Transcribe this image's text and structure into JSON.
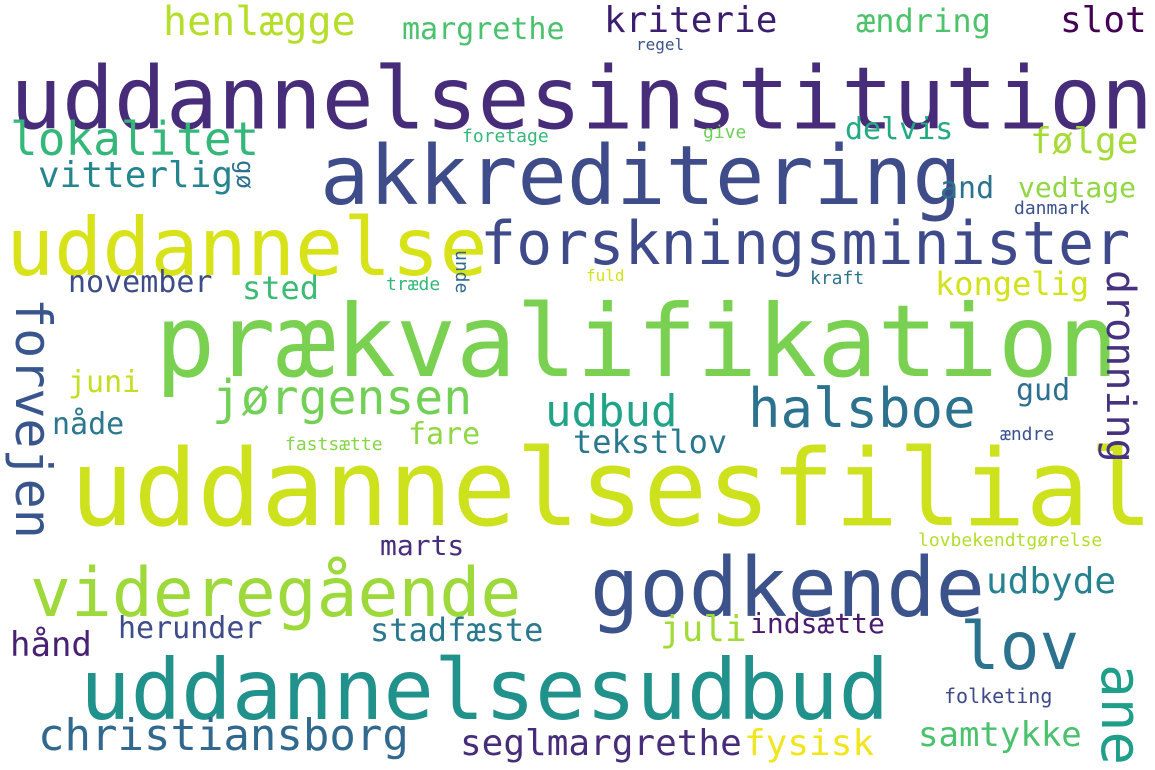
{
  "words": [
    {
      "text": "uddannelsesinstitution",
      "color": "#472c7a"
    },
    {
      "text": "akkreditering",
      "color": "#3e4c8a"
    },
    {
      "text": "uddannelse",
      "color": "#d8e219"
    },
    {
      "text": "forskningsminister",
      "color": "#3e4a89"
    },
    {
      "text": "prækvalifikation",
      "color": "#7ad151"
    },
    {
      "text": "uddannelsesfilial",
      "color": "#cde11d"
    },
    {
      "text": "videregående",
      "color": "#9dd93b"
    },
    {
      "text": "godkende",
      "color": "#3b528b"
    },
    {
      "text": "uddannelsesudbud",
      "color": "#21918c"
    },
    {
      "text": "halsboe",
      "color": "#2c728e"
    },
    {
      "text": "jørgensen",
      "color": "#73d056"
    },
    {
      "text": "udbud",
      "color": "#20a386"
    },
    {
      "text": "lokalitet",
      "color": "#35b779"
    },
    {
      "text": "henlægge",
      "color": "#b5de2b"
    },
    {
      "text": "margrethe",
      "color": "#4ac16d"
    },
    {
      "text": "kriterie",
      "color": "#3b1f6e"
    },
    {
      "text": "ændring",
      "color": "#4ec36b"
    },
    {
      "text": "slot",
      "color": "#440154"
    },
    {
      "text": "regel",
      "color": "#3b528b"
    },
    {
      "text": "foretage",
      "color": "#35b779"
    },
    {
      "text": "give",
      "color": "#6ece58"
    },
    {
      "text": "delvis",
      "color": "#23a983"
    },
    {
      "text": "følge",
      "color": "#a5db36"
    },
    {
      "text": "vitterlig",
      "color": "#25858e"
    },
    {
      "text": "gø",
      "color": "#2d708e"
    },
    {
      "text": "and",
      "color": "#2c728e"
    },
    {
      "text": "vedtage",
      "color": "#90d743"
    },
    {
      "text": "danmark",
      "color": "#3b528b"
    },
    {
      "text": "forvejen",
      "color": "#39568c"
    },
    {
      "text": "november",
      "color": "#3e4c8a"
    },
    {
      "text": "sted",
      "color": "#3bbb75"
    },
    {
      "text": "træde",
      "color": "#35b779"
    },
    {
      "text": "unde",
      "color": "#31688e"
    },
    {
      "text": "fuld",
      "color": "#d2e21b"
    },
    {
      "text": "kraft",
      "color": "#2c728e"
    },
    {
      "text": "kongelig",
      "color": "#d2e21b"
    },
    {
      "text": "dronning",
      "color": "#46327e"
    },
    {
      "text": "juni",
      "color": "#c2df23"
    },
    {
      "text": "gud",
      "color": "#2e6e8e"
    },
    {
      "text": "nåde",
      "color": "#2a788e"
    },
    {
      "text": "fare",
      "color": "#8fd744"
    },
    {
      "text": "tekstlov",
      "color": "#2a788e"
    },
    {
      "text": "fastsætte",
      "color": "#86d549"
    },
    {
      "text": "ændre",
      "color": "#3b528b"
    },
    {
      "text": "lov",
      "color": "#2c728e"
    },
    {
      "text": "marts",
      "color": "#472d7b"
    },
    {
      "text": "lovbekendtgørelse",
      "color": "#b2dd2d"
    },
    {
      "text": "udbyde",
      "color": "#26828e"
    },
    {
      "text": "herunder",
      "color": "#3e4c8a"
    },
    {
      "text": "stadfæste",
      "color": "#2a788e"
    },
    {
      "text": "juli",
      "color": "#a2da37"
    },
    {
      "text": "indsætte",
      "color": "#481b6d"
    },
    {
      "text": "hånd",
      "color": "#482173"
    },
    {
      "text": "ane",
      "color": "#1f9e89"
    },
    {
      "text": "folketing",
      "color": "#3e4989"
    },
    {
      "text": "christiansborg",
      "color": "#31688e"
    },
    {
      "text": "seglmargrethe",
      "color": "#472c7a"
    },
    {
      "text": "fysisk",
      "color": "#f1e51d"
    },
    {
      "text": "samtykke",
      "color": "#4ac16d"
    }
  ]
}
